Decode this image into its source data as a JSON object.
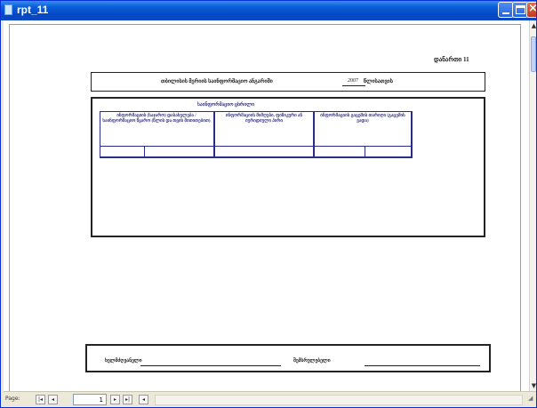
{
  "window": {
    "title": "rpt_11"
  },
  "report": {
    "annex_label": "დანართი 11",
    "header_text": "თბილისის მერიის საინფორმაციო ანგარიში",
    "year": "2007",
    "year_suffix": "წლისათვის",
    "table_caption": "საინფორმაციო ცხრილი",
    "column_headers": [
      "ინფორმაციის (საჯარო) დასახელება / საინფორმაციო წყარო (წლის და თვის მითითებით)",
      "ინფორმაციის მიმღები, ფიზიკური ან იურიდიული პირი",
      "ინფორმაციის გაცემის თარიღი (გაცემის ვადა)"
    ],
    "sign_labels": [
      "ხელმძღვანელი",
      "შემსრულებელი"
    ]
  },
  "statusbar": {
    "page_label": "Page:",
    "page_value": "1",
    "nav_first": "|◂",
    "nav_prev": "◂",
    "nav_next": "▸",
    "nav_last": "▸|",
    "extra": "◂"
  }
}
